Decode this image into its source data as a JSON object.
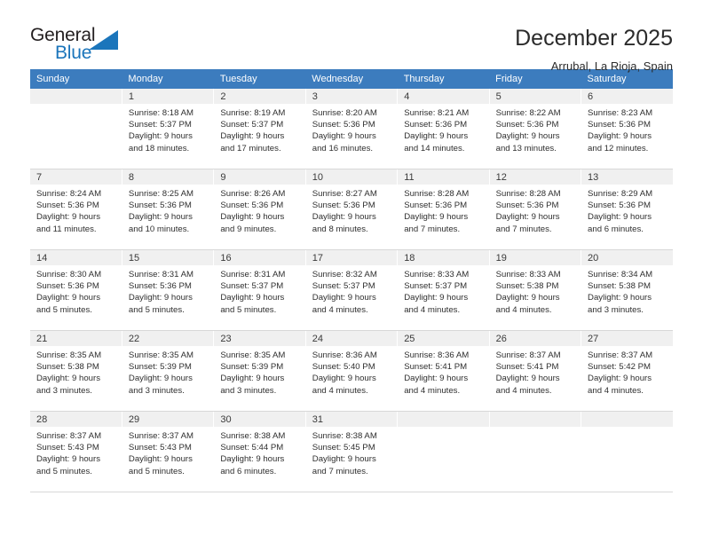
{
  "brand": {
    "name_part1": "General",
    "name_part2": "Blue",
    "accent_color": "#1b75bb"
  },
  "header": {
    "title": "December 2025",
    "subtitle": "Arrubal, La Rioja, Spain"
  },
  "theme": {
    "header_row_color": "#3c7cbe",
    "daynum_band_color": "#f0f0f0",
    "grid_line_color": "#d8d8d8"
  },
  "weekday_headers": [
    "Sunday",
    "Monday",
    "Tuesday",
    "Wednesday",
    "Thursday",
    "Friday",
    "Saturday"
  ],
  "weeks": [
    [
      {
        "day": "",
        "empty": true,
        "sunrise": "",
        "sunset": "",
        "daylight_line1": "",
        "daylight_line2": ""
      },
      {
        "day": "1",
        "sunrise": "Sunrise: 8:18 AM",
        "sunset": "Sunset: 5:37 PM",
        "daylight_line1": "Daylight: 9 hours",
        "daylight_line2": "and 18 minutes."
      },
      {
        "day": "2",
        "sunrise": "Sunrise: 8:19 AM",
        "sunset": "Sunset: 5:37 PM",
        "daylight_line1": "Daylight: 9 hours",
        "daylight_line2": "and 17 minutes."
      },
      {
        "day": "3",
        "sunrise": "Sunrise: 8:20 AM",
        "sunset": "Sunset: 5:36 PM",
        "daylight_line1": "Daylight: 9 hours",
        "daylight_line2": "and 16 minutes."
      },
      {
        "day": "4",
        "sunrise": "Sunrise: 8:21 AM",
        "sunset": "Sunset: 5:36 PM",
        "daylight_line1": "Daylight: 9 hours",
        "daylight_line2": "and 14 minutes."
      },
      {
        "day": "5",
        "sunrise": "Sunrise: 8:22 AM",
        "sunset": "Sunset: 5:36 PM",
        "daylight_line1": "Daylight: 9 hours",
        "daylight_line2": "and 13 minutes."
      },
      {
        "day": "6",
        "sunrise": "Sunrise: 8:23 AM",
        "sunset": "Sunset: 5:36 PM",
        "daylight_line1": "Daylight: 9 hours",
        "daylight_line2": "and 12 minutes."
      }
    ],
    [
      {
        "day": "7",
        "sunrise": "Sunrise: 8:24 AM",
        "sunset": "Sunset: 5:36 PM",
        "daylight_line1": "Daylight: 9 hours",
        "daylight_line2": "and 11 minutes."
      },
      {
        "day": "8",
        "sunrise": "Sunrise: 8:25 AM",
        "sunset": "Sunset: 5:36 PM",
        "daylight_line1": "Daylight: 9 hours",
        "daylight_line2": "and 10 minutes."
      },
      {
        "day": "9",
        "sunrise": "Sunrise: 8:26 AM",
        "sunset": "Sunset: 5:36 PM",
        "daylight_line1": "Daylight: 9 hours",
        "daylight_line2": "and 9 minutes."
      },
      {
        "day": "10",
        "sunrise": "Sunrise: 8:27 AM",
        "sunset": "Sunset: 5:36 PM",
        "daylight_line1": "Daylight: 9 hours",
        "daylight_line2": "and 8 minutes."
      },
      {
        "day": "11",
        "sunrise": "Sunrise: 8:28 AM",
        "sunset": "Sunset: 5:36 PM",
        "daylight_line1": "Daylight: 9 hours",
        "daylight_line2": "and 7 minutes."
      },
      {
        "day": "12",
        "sunrise": "Sunrise: 8:28 AM",
        "sunset": "Sunset: 5:36 PM",
        "daylight_line1": "Daylight: 9 hours",
        "daylight_line2": "and 7 minutes."
      },
      {
        "day": "13",
        "sunrise": "Sunrise: 8:29 AM",
        "sunset": "Sunset: 5:36 PM",
        "daylight_line1": "Daylight: 9 hours",
        "daylight_line2": "and 6 minutes."
      }
    ],
    [
      {
        "day": "14",
        "sunrise": "Sunrise: 8:30 AM",
        "sunset": "Sunset: 5:36 PM",
        "daylight_line1": "Daylight: 9 hours",
        "daylight_line2": "and 5 minutes."
      },
      {
        "day": "15",
        "sunrise": "Sunrise: 8:31 AM",
        "sunset": "Sunset: 5:36 PM",
        "daylight_line1": "Daylight: 9 hours",
        "daylight_line2": "and 5 minutes."
      },
      {
        "day": "16",
        "sunrise": "Sunrise: 8:31 AM",
        "sunset": "Sunset: 5:37 PM",
        "daylight_line1": "Daylight: 9 hours",
        "daylight_line2": "and 5 minutes."
      },
      {
        "day": "17",
        "sunrise": "Sunrise: 8:32 AM",
        "sunset": "Sunset: 5:37 PM",
        "daylight_line1": "Daylight: 9 hours",
        "daylight_line2": "and 4 minutes."
      },
      {
        "day": "18",
        "sunrise": "Sunrise: 8:33 AM",
        "sunset": "Sunset: 5:37 PM",
        "daylight_line1": "Daylight: 9 hours",
        "daylight_line2": "and 4 minutes."
      },
      {
        "day": "19",
        "sunrise": "Sunrise: 8:33 AM",
        "sunset": "Sunset: 5:38 PM",
        "daylight_line1": "Daylight: 9 hours",
        "daylight_line2": "and 4 minutes."
      },
      {
        "day": "20",
        "sunrise": "Sunrise: 8:34 AM",
        "sunset": "Sunset: 5:38 PM",
        "daylight_line1": "Daylight: 9 hours",
        "daylight_line2": "and 3 minutes."
      }
    ],
    [
      {
        "day": "21",
        "sunrise": "Sunrise: 8:35 AM",
        "sunset": "Sunset: 5:38 PM",
        "daylight_line1": "Daylight: 9 hours",
        "daylight_line2": "and 3 minutes."
      },
      {
        "day": "22",
        "sunrise": "Sunrise: 8:35 AM",
        "sunset": "Sunset: 5:39 PM",
        "daylight_line1": "Daylight: 9 hours",
        "daylight_line2": "and 3 minutes."
      },
      {
        "day": "23",
        "sunrise": "Sunrise: 8:35 AM",
        "sunset": "Sunset: 5:39 PM",
        "daylight_line1": "Daylight: 9 hours",
        "daylight_line2": "and 3 minutes."
      },
      {
        "day": "24",
        "sunrise": "Sunrise: 8:36 AM",
        "sunset": "Sunset: 5:40 PM",
        "daylight_line1": "Daylight: 9 hours",
        "daylight_line2": "and 4 minutes."
      },
      {
        "day": "25",
        "sunrise": "Sunrise: 8:36 AM",
        "sunset": "Sunset: 5:41 PM",
        "daylight_line1": "Daylight: 9 hours",
        "daylight_line2": "and 4 minutes."
      },
      {
        "day": "26",
        "sunrise": "Sunrise: 8:37 AM",
        "sunset": "Sunset: 5:41 PM",
        "daylight_line1": "Daylight: 9 hours",
        "daylight_line2": "and 4 minutes."
      },
      {
        "day": "27",
        "sunrise": "Sunrise: 8:37 AM",
        "sunset": "Sunset: 5:42 PM",
        "daylight_line1": "Daylight: 9 hours",
        "daylight_line2": "and 4 minutes."
      }
    ],
    [
      {
        "day": "28",
        "sunrise": "Sunrise: 8:37 AM",
        "sunset": "Sunset: 5:43 PM",
        "daylight_line1": "Daylight: 9 hours",
        "daylight_line2": "and 5 minutes."
      },
      {
        "day": "29",
        "sunrise": "Sunrise: 8:37 AM",
        "sunset": "Sunset: 5:43 PM",
        "daylight_line1": "Daylight: 9 hours",
        "daylight_line2": "and 5 minutes."
      },
      {
        "day": "30",
        "sunrise": "Sunrise: 8:38 AM",
        "sunset": "Sunset: 5:44 PM",
        "daylight_line1": "Daylight: 9 hours",
        "daylight_line2": "and 6 minutes."
      },
      {
        "day": "31",
        "sunrise": "Sunrise: 8:38 AM",
        "sunset": "Sunset: 5:45 PM",
        "daylight_line1": "Daylight: 9 hours",
        "daylight_line2": "and 7 minutes."
      },
      {
        "day": "",
        "empty": true,
        "sunrise": "",
        "sunset": "",
        "daylight_line1": "",
        "daylight_line2": ""
      },
      {
        "day": "",
        "empty": true,
        "sunrise": "",
        "sunset": "",
        "daylight_line1": "",
        "daylight_line2": ""
      },
      {
        "day": "",
        "empty": true,
        "sunrise": "",
        "sunset": "",
        "daylight_line1": "",
        "daylight_line2": ""
      }
    ]
  ]
}
